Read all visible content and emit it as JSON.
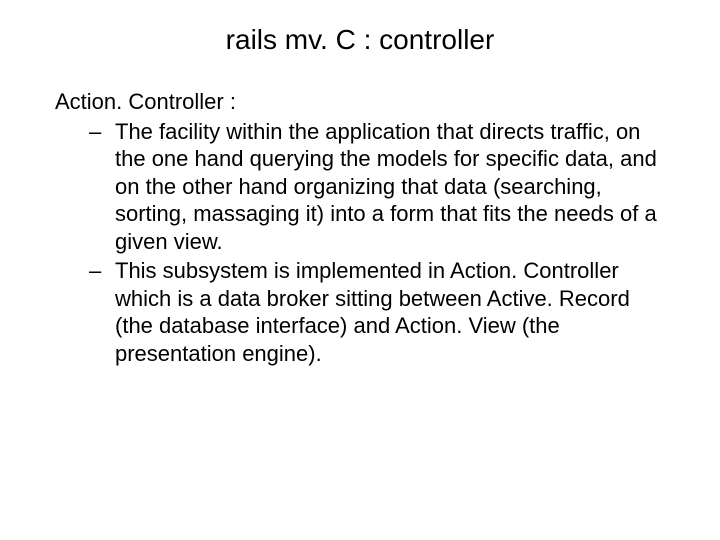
{
  "title": "rails mv. C : controller",
  "topic": "Action. Controller :",
  "bullets": [
    "The facility within the application that directs traffic, on the one hand querying the models for specific data, and on the other hand organizing that data (searching, sorting, massaging it) into a form that fits the needs of a given view.",
    "This subsystem is implemented in Action. Controller which is a data broker sitting between Active. Record (the database interface) and Action. View (the presentation engine)."
  ]
}
